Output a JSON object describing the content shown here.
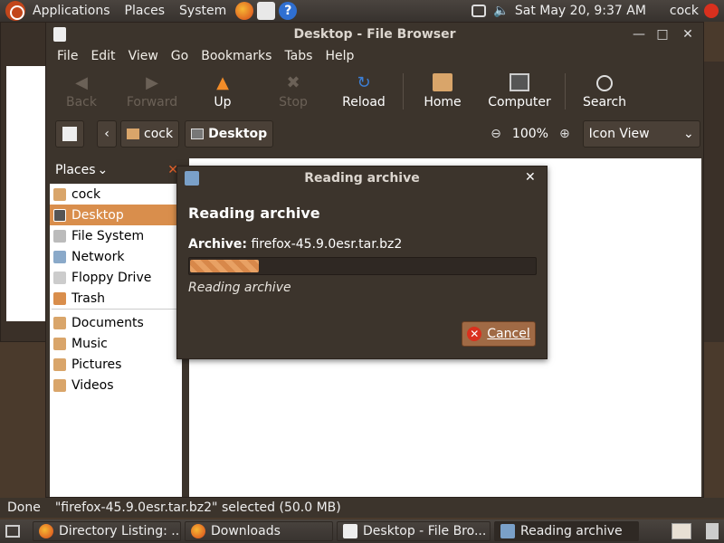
{
  "top_panel": {
    "menus": [
      "Applications",
      "Places",
      "System"
    ],
    "clock": "Sat May 20,  9:37 AM",
    "user": "cock"
  },
  "window": {
    "title": "Desktop - File Browser",
    "menubar": [
      "File",
      "Edit",
      "View",
      "Go",
      "Bookmarks",
      "Tabs",
      "Help"
    ],
    "toolbar": {
      "back": "Back",
      "forward": "Forward",
      "up": "Up",
      "stop": "Stop",
      "reload": "Reload",
      "home": "Home",
      "computer": "Computer",
      "search": "Search"
    },
    "location": {
      "crumb_home": "cock",
      "crumb_current": "Desktop",
      "zoom": "100%",
      "view_mode": "Icon View"
    },
    "sidebar": {
      "header": "Places",
      "items": [
        {
          "label": "cock",
          "icon": "home-icon"
        },
        {
          "label": "Desktop",
          "icon": "desktop-icon",
          "selected": true
        },
        {
          "label": "File System",
          "icon": "drive-icon"
        },
        {
          "label": "Network",
          "icon": "network-icon"
        },
        {
          "label": "Floppy Drive",
          "icon": "floppy-icon"
        },
        {
          "label": "Trash",
          "icon": "trash-icon"
        }
      ],
      "bookmarks": [
        {
          "label": "Documents"
        },
        {
          "label": "Music"
        },
        {
          "label": "Pictures"
        },
        {
          "label": "Videos"
        }
      ]
    }
  },
  "statusbar": {
    "left": "Done",
    "text": "\"firefox-45.9.0esr.tar.bz2\" selected (50.0 MB)"
  },
  "dialog": {
    "title": "Reading archive",
    "heading": "Reading archive",
    "archive_label": "Archive:",
    "archive_name": "firefox-45.9.0esr.tar.bz2",
    "progress_fraction": 0.2,
    "status": "Reading archive",
    "cancel": "Cancel"
  },
  "taskbar": [
    {
      "label": "Directory Listing: ...",
      "icon": "firefox-icon"
    },
    {
      "label": "Downloads",
      "icon": "firefox-icon"
    },
    {
      "label": "Desktop - File Bro...",
      "icon": "file-browser-icon"
    },
    {
      "label": "Reading archive",
      "icon": "archive-icon"
    }
  ],
  "colors": {
    "accent": "#d98e4c",
    "panel": "#3c342c"
  }
}
